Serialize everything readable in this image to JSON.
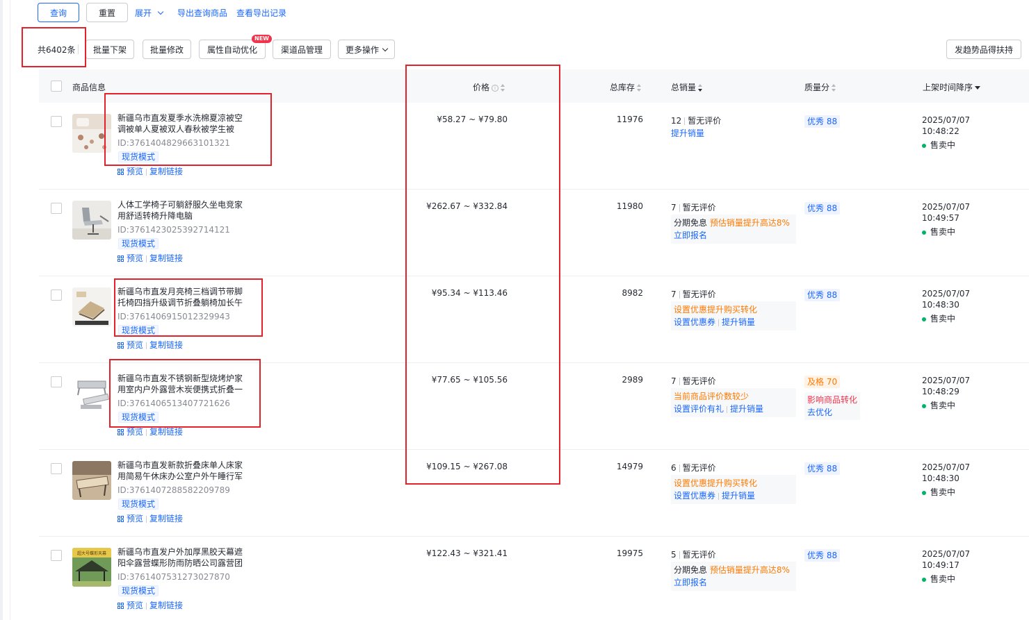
{
  "toolbar": {
    "query": "查询",
    "reset": "重置",
    "expand": "展开",
    "export_query": "导出查询商品",
    "export_records": "查看导出记录"
  },
  "bulk": {
    "count": "共6402条",
    "batch_delist": "批量下架",
    "batch_edit": "批量修改",
    "attr_optimize": "属性自动优化",
    "new_badge": "NEW",
    "channel": "渠道品管理",
    "more": "更多操作",
    "trend_support": "发趋势品得扶持"
  },
  "columns": {
    "product": "商品信息",
    "price": "价格",
    "stock": "总库存",
    "sales": "总销量",
    "quality": "质量分",
    "listed_time": "上架时间降序"
  },
  "common": {
    "tag": "现货模式",
    "preview": "预览",
    "copy_link": "复制链接",
    "status": "售卖中"
  },
  "rows": [
    {
      "title": "新疆乌市直发夏季水洗棉夏凉被空调被单人夏被双人春秋被学生被",
      "id": "ID:3761404829663101321",
      "price": "¥58.27 ~ ¥79.80",
      "stock": "11976",
      "sales_count": "12",
      "rating": "暂无评价",
      "sales_link": "提升销量",
      "quality": "优秀 88",
      "date": "2025/07/07",
      "time": "10:48:22"
    },
    {
      "title": "人体工学椅子可躺舒服久坐电竞家用舒适转椅升降电脑",
      "id": "ID:3761423025392714121",
      "price": "¥262.67 ~ ¥332.84",
      "stock": "11980",
      "sales_count": "7",
      "rating": "暂无评价",
      "box_line1_a": "分期免息",
      "box_line1_b": "预估销量提升高达8%",
      "box_line2": "立即报名",
      "quality": "优秀 88",
      "date": "2025/07/07",
      "time": "10:49:57"
    },
    {
      "title": "新疆乌市直发月亮椅三档调节带脚托椅四挡升级调节折叠躺椅加长午",
      "id": "ID:3761406915012329943",
      "price": "¥95.34 ~ ¥113.46",
      "stock": "8982",
      "sales_count": "7",
      "rating": "暂无评价",
      "box_line1": "设置优惠提升购买转化",
      "box_link_a": "设置优惠券",
      "box_link_b": "提升销量",
      "quality": "优秀 88",
      "date": "2025/07/07",
      "time": "10:48:30"
    },
    {
      "title": "新疆乌市直发不锈钢新型烧烤炉家用室内户外露营木炭便携式折叠一",
      "id": "ID:3761406513407721626",
      "price": "¥77.65 ~ ¥105.56",
      "stock": "2989",
      "sales_count": "7",
      "rating": "暂无评价",
      "box_line1": "当前商品评价数较少",
      "box_link_a": "设置评价有礼",
      "box_link_b": "提升销量",
      "quality": "及格 70",
      "quality_note": "影响商品转化",
      "quality_link": "去优化",
      "date": "2025/07/07",
      "time": "10:48:29"
    },
    {
      "title": "新疆乌市直发新款折叠床单人床家用简易午休床办公室户外午睡行军",
      "id": "ID:3761407288582209789",
      "price": "¥109.15 ~ ¥267.08",
      "stock": "14979",
      "sales_count": "6",
      "rating": "暂无评价",
      "box_line1": "设置优惠提升购买转化",
      "box_link_a": "设置优惠券",
      "box_link_b": "提升销量",
      "quality": "优秀 88",
      "date": "2025/07/07",
      "time": "10:48:30"
    },
    {
      "title": "新疆乌市直发户外加厚黑胶天幕遮阳伞露营蝶形防雨防晒公司露营团",
      "id": "ID:3761407531273027870",
      "price": "¥122.43 ~ ¥321.41",
      "stock": "19975",
      "sales_count": "5",
      "rating": "暂无评价",
      "box_line1_a": "分期免息",
      "box_line1_b": "预估销量提升高达8%",
      "box_line2": "立即报名",
      "quality": "优秀 88",
      "thumb_text": "超大号蝶形天幕",
      "date": "2025/07/07",
      "time": "10:49:17"
    }
  ]
}
